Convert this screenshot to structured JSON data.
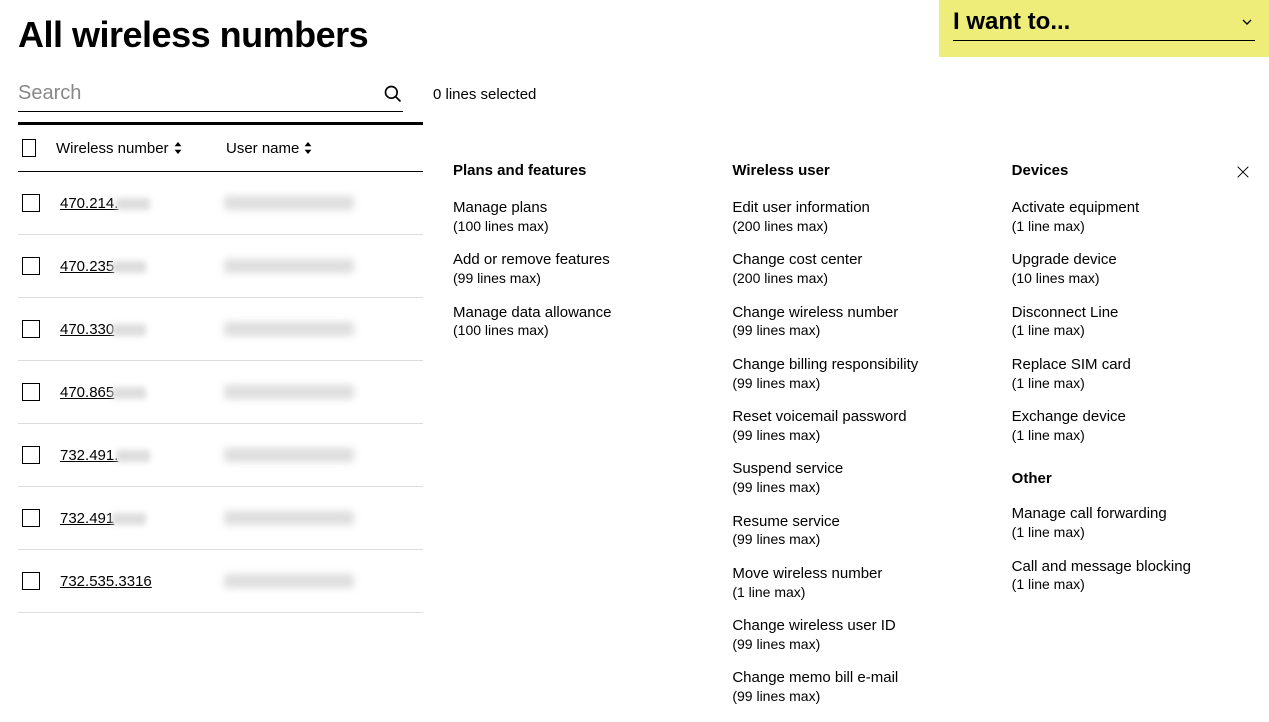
{
  "page_title": "All wireless numbers",
  "search": {
    "placeholder": "Search"
  },
  "selection_status": "0 lines selected",
  "i_want_to": {
    "label": "I want to..."
  },
  "table": {
    "headers": {
      "number": "Wireless number",
      "user": "User name"
    },
    "rows": [
      {
        "number_visible": "470.214."
      },
      {
        "number_visible": "470.235"
      },
      {
        "number_visible": "470.330"
      },
      {
        "number_visible": "470.865"
      },
      {
        "number_visible": "732.491."
      },
      {
        "number_visible": "732.491"
      },
      {
        "number_visible": "732.535.3316",
        "full": true
      }
    ]
  },
  "panel": {
    "plans": {
      "heading": "Plans and features",
      "actions": [
        {
          "label": "Manage plans",
          "note": "(100 lines max)"
        },
        {
          "label": "Add or remove features",
          "note": "(99 lines max)"
        },
        {
          "label": "Manage data allowance",
          "note": "(100 lines max)"
        }
      ]
    },
    "user": {
      "heading": "Wireless user",
      "actions": [
        {
          "label": "Edit user information",
          "note": "(200 lines max)"
        },
        {
          "label": "Change cost center",
          "note": "(200 lines max)"
        },
        {
          "label": "Change wireless number",
          "note": "(99 lines max)"
        },
        {
          "label": "Change billing responsibility",
          "note": "(99 lines max)"
        },
        {
          "label": "Reset voicemail password",
          "note": "(99 lines max)"
        },
        {
          "label": "Suspend service",
          "note": "(99 lines max)"
        },
        {
          "label": "Resume service",
          "note": "(99 lines max)"
        },
        {
          "label": "Move wireless number",
          "note": "(1 line max)"
        },
        {
          "label": "Change wireless user ID",
          "note": "(99 lines max)"
        },
        {
          "label": "Change memo bill e-mail",
          "note": "(99 lines max)"
        }
      ]
    },
    "devices": {
      "heading": "Devices",
      "actions": [
        {
          "label": "Activate equipment",
          "note": "(1 line max)"
        },
        {
          "label": "Upgrade device",
          "note": "(10 lines max)"
        },
        {
          "label": "Disconnect Line",
          "note": "(1 line max)"
        },
        {
          "label": "Replace SIM card",
          "note": "(1 line max)"
        },
        {
          "label": "Exchange device",
          "note": "(1 line max)"
        }
      ]
    },
    "other": {
      "heading": "Other",
      "actions": [
        {
          "label": "Manage call forwarding",
          "note": "(1 line max)"
        },
        {
          "label": "Call and message blocking",
          "note": "(1 line max)"
        }
      ]
    }
  }
}
